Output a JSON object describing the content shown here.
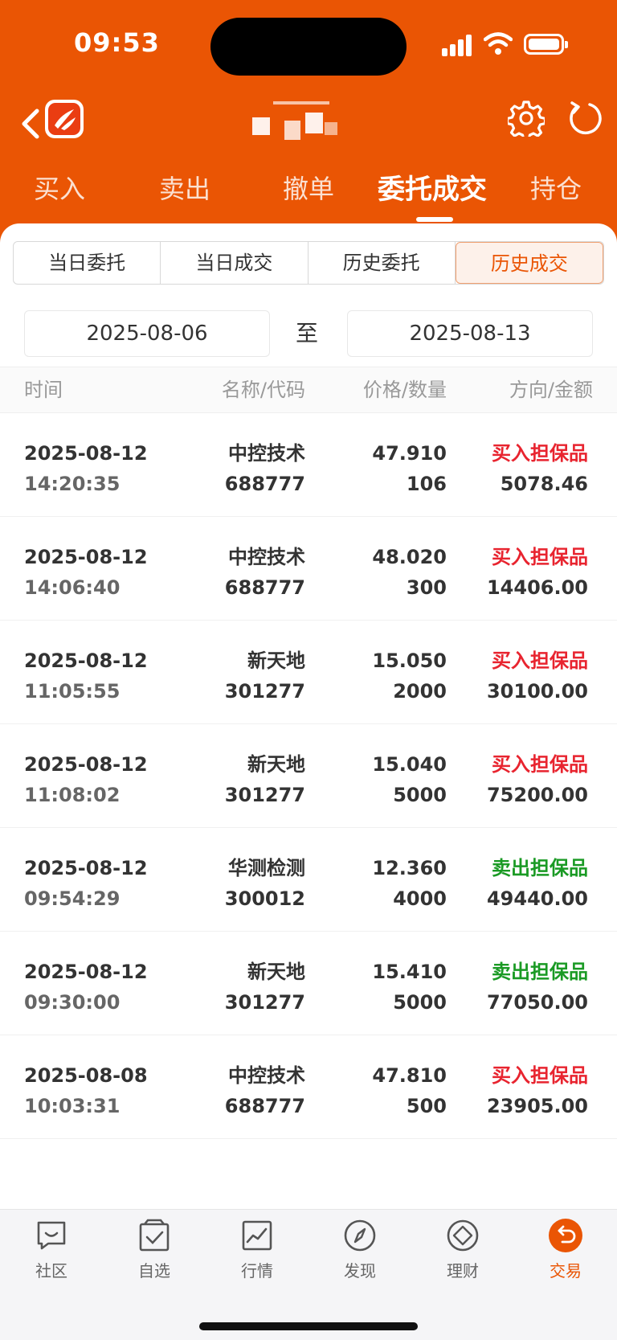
{
  "status": {
    "time": "09:53"
  },
  "top_tabs": [
    {
      "label": "买入"
    },
    {
      "label": "卖出"
    },
    {
      "label": "撤单"
    },
    {
      "label": "委托成交"
    },
    {
      "label": "持仓"
    }
  ],
  "active_top_tab": "委托成交",
  "segments": [
    {
      "label": "当日委托"
    },
    {
      "label": "当日成交"
    },
    {
      "label": "历史委托"
    },
    {
      "label": "历史成交"
    }
  ],
  "active_segment": "历史成交",
  "date_range": {
    "start": "2025-08-06",
    "separator": "至",
    "end": "2025-08-13"
  },
  "table": {
    "headers": [
      "时间",
      "名称/代码",
      "价格/数量",
      "方向/金额"
    ],
    "rows": [
      {
        "date": "2025-08-12",
        "time": "14:20:35",
        "name": "中控技术",
        "code": "688777",
        "price": "47.910",
        "qty": "106",
        "direction": "买入担保品",
        "amount": "5078.46"
      },
      {
        "date": "2025-08-12",
        "time": "14:06:40",
        "name": "中控技术",
        "code": "688777",
        "price": "48.020",
        "qty": "300",
        "direction": "买入担保品",
        "amount": "14406.00"
      },
      {
        "date": "2025-08-12",
        "time": "11:05:55",
        "name": "新天地",
        "code": "301277",
        "price": "15.050",
        "qty": "2000",
        "direction": "买入担保品",
        "amount": "30100.00"
      },
      {
        "date": "2025-08-12",
        "time": "11:08:02",
        "name": "新天地",
        "code": "301277",
        "price": "15.040",
        "qty": "5000",
        "direction": "买入担保品",
        "amount": "75200.00"
      },
      {
        "date": "2025-08-12",
        "time": "09:54:29",
        "name": "华测检测",
        "code": "300012",
        "price": "12.360",
        "qty": "4000",
        "direction": "卖出担保品",
        "amount": "49440.00"
      },
      {
        "date": "2025-08-12",
        "time": "09:30:00",
        "name": "新天地",
        "code": "301277",
        "price": "15.410",
        "qty": "5000",
        "direction": "卖出担保品",
        "amount": "77050.00"
      },
      {
        "date": "2025-08-08",
        "time": "10:03:31",
        "name": "中控技术",
        "code": "688777",
        "price": "47.810",
        "qty": "500",
        "direction": "买入担保品",
        "amount": "23905.00"
      }
    ]
  },
  "colors": {
    "brand": "#ea5504",
    "buy": "#e8242f",
    "sell": "#1a9a24"
  },
  "bottom_nav": [
    {
      "label": "社区",
      "icon": "chat-bubble-icon"
    },
    {
      "label": "自选",
      "icon": "checked-box-icon"
    },
    {
      "label": "行情",
      "icon": "line-chart-icon"
    },
    {
      "label": "发现",
      "icon": "compass-icon"
    },
    {
      "label": "理财",
      "icon": "diamond-icon"
    },
    {
      "label": "交易",
      "icon": "swap-arrow-icon"
    }
  ],
  "active_nav": "交易"
}
